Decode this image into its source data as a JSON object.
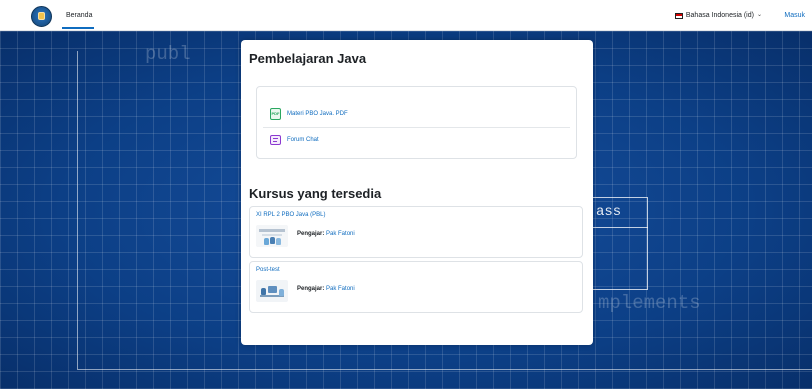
{
  "navbar": {
    "home_label": "Beranda",
    "language_label": "Bahasa Indonesia (id)",
    "language_chevron": "⌄",
    "login_label": "Masuk"
  },
  "background": {
    "code_public": "publ",
    "code_class": "ass",
    "code_implements": "mplements"
  },
  "card": {
    "title": "Pembelajaran Java",
    "activities": [
      {
        "label": "Materi PBO Java. PDF",
        "icon": "pdf-icon",
        "icon_text": "PDF"
      },
      {
        "label": "Forum Chat",
        "icon": "forum-icon"
      }
    ],
    "courses_heading": "Kursus yang tersedia",
    "courses": [
      {
        "name": "XI RPL 2 PBO Java (PBL)",
        "teacher_label": "Pengajar:",
        "teacher": "Pak Fatoni"
      },
      {
        "name": "Post-test",
        "teacher_label": "Pengajar:",
        "teacher": "Pak Fatoni"
      }
    ]
  },
  "colors": {
    "accent": "#0f6cbf",
    "background": "#0b3f8a",
    "card": "#ffffff"
  }
}
